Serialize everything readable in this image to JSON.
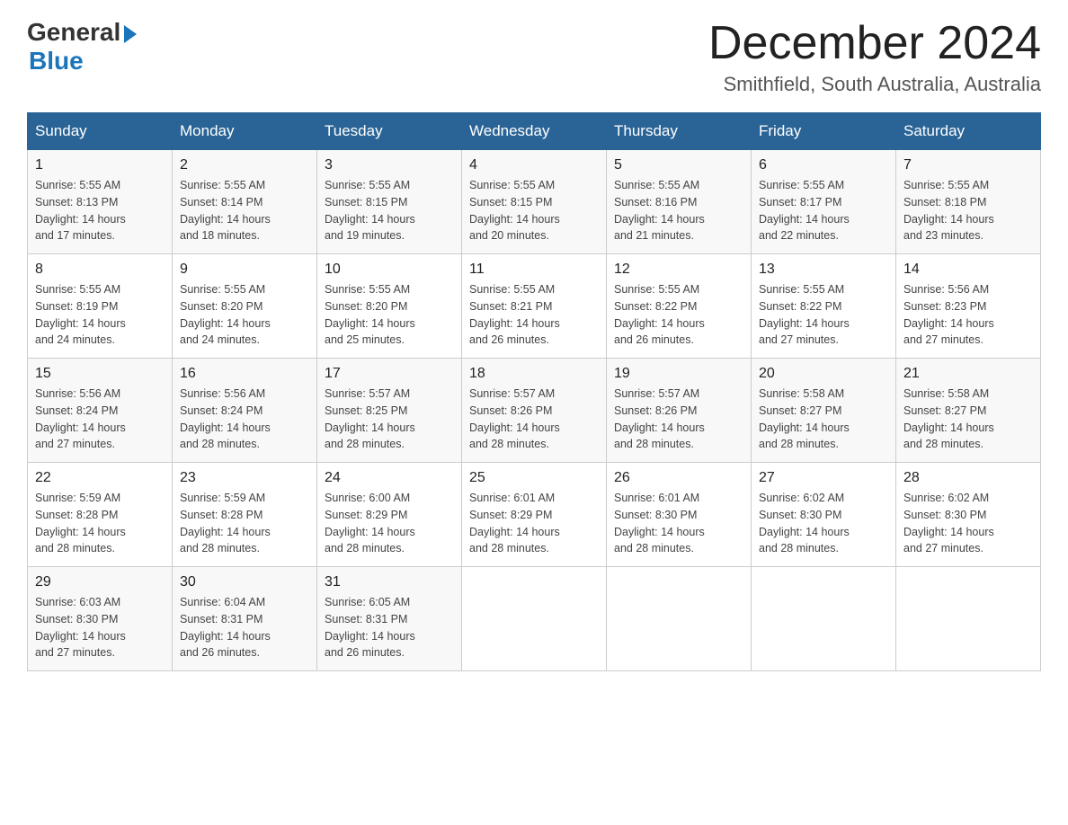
{
  "header": {
    "logo_general": "General",
    "logo_blue": "Blue",
    "month_title": "December 2024",
    "subtitle": "Smithfield, South Australia, Australia"
  },
  "weekdays": [
    "Sunday",
    "Monday",
    "Tuesday",
    "Wednesday",
    "Thursday",
    "Friday",
    "Saturday"
  ],
  "weeks": [
    [
      {
        "day": "1",
        "sunrise": "5:55 AM",
        "sunset": "8:13 PM",
        "daylight": "14 hours and 17 minutes."
      },
      {
        "day": "2",
        "sunrise": "5:55 AM",
        "sunset": "8:14 PM",
        "daylight": "14 hours and 18 minutes."
      },
      {
        "day": "3",
        "sunrise": "5:55 AM",
        "sunset": "8:15 PM",
        "daylight": "14 hours and 19 minutes."
      },
      {
        "day": "4",
        "sunrise": "5:55 AM",
        "sunset": "8:15 PM",
        "daylight": "14 hours and 20 minutes."
      },
      {
        "day": "5",
        "sunrise": "5:55 AM",
        "sunset": "8:16 PM",
        "daylight": "14 hours and 21 minutes."
      },
      {
        "day": "6",
        "sunrise": "5:55 AM",
        "sunset": "8:17 PM",
        "daylight": "14 hours and 22 minutes."
      },
      {
        "day": "7",
        "sunrise": "5:55 AM",
        "sunset": "8:18 PM",
        "daylight": "14 hours and 23 minutes."
      }
    ],
    [
      {
        "day": "8",
        "sunrise": "5:55 AM",
        "sunset": "8:19 PM",
        "daylight": "14 hours and 24 minutes."
      },
      {
        "day": "9",
        "sunrise": "5:55 AM",
        "sunset": "8:20 PM",
        "daylight": "14 hours and 24 minutes."
      },
      {
        "day": "10",
        "sunrise": "5:55 AM",
        "sunset": "8:20 PM",
        "daylight": "14 hours and 25 minutes."
      },
      {
        "day": "11",
        "sunrise": "5:55 AM",
        "sunset": "8:21 PM",
        "daylight": "14 hours and 26 minutes."
      },
      {
        "day": "12",
        "sunrise": "5:55 AM",
        "sunset": "8:22 PM",
        "daylight": "14 hours and 26 minutes."
      },
      {
        "day": "13",
        "sunrise": "5:55 AM",
        "sunset": "8:22 PM",
        "daylight": "14 hours and 27 minutes."
      },
      {
        "day": "14",
        "sunrise": "5:56 AM",
        "sunset": "8:23 PM",
        "daylight": "14 hours and 27 minutes."
      }
    ],
    [
      {
        "day": "15",
        "sunrise": "5:56 AM",
        "sunset": "8:24 PM",
        "daylight": "14 hours and 27 minutes."
      },
      {
        "day": "16",
        "sunrise": "5:56 AM",
        "sunset": "8:24 PM",
        "daylight": "14 hours and 28 minutes."
      },
      {
        "day": "17",
        "sunrise": "5:57 AM",
        "sunset": "8:25 PM",
        "daylight": "14 hours and 28 minutes."
      },
      {
        "day": "18",
        "sunrise": "5:57 AM",
        "sunset": "8:26 PM",
        "daylight": "14 hours and 28 minutes."
      },
      {
        "day": "19",
        "sunrise": "5:57 AM",
        "sunset": "8:26 PM",
        "daylight": "14 hours and 28 minutes."
      },
      {
        "day": "20",
        "sunrise": "5:58 AM",
        "sunset": "8:27 PM",
        "daylight": "14 hours and 28 minutes."
      },
      {
        "day": "21",
        "sunrise": "5:58 AM",
        "sunset": "8:27 PM",
        "daylight": "14 hours and 28 minutes."
      }
    ],
    [
      {
        "day": "22",
        "sunrise": "5:59 AM",
        "sunset": "8:28 PM",
        "daylight": "14 hours and 28 minutes."
      },
      {
        "day": "23",
        "sunrise": "5:59 AM",
        "sunset": "8:28 PM",
        "daylight": "14 hours and 28 minutes."
      },
      {
        "day": "24",
        "sunrise": "6:00 AM",
        "sunset": "8:29 PM",
        "daylight": "14 hours and 28 minutes."
      },
      {
        "day": "25",
        "sunrise": "6:01 AM",
        "sunset": "8:29 PM",
        "daylight": "14 hours and 28 minutes."
      },
      {
        "day": "26",
        "sunrise": "6:01 AM",
        "sunset": "8:30 PM",
        "daylight": "14 hours and 28 minutes."
      },
      {
        "day": "27",
        "sunrise": "6:02 AM",
        "sunset": "8:30 PM",
        "daylight": "14 hours and 28 minutes."
      },
      {
        "day": "28",
        "sunrise": "6:02 AM",
        "sunset": "8:30 PM",
        "daylight": "14 hours and 27 minutes."
      }
    ],
    [
      {
        "day": "29",
        "sunrise": "6:03 AM",
        "sunset": "8:30 PM",
        "daylight": "14 hours and 27 minutes."
      },
      {
        "day": "30",
        "sunrise": "6:04 AM",
        "sunset": "8:31 PM",
        "daylight": "14 hours and 26 minutes."
      },
      {
        "day": "31",
        "sunrise": "6:05 AM",
        "sunset": "8:31 PM",
        "daylight": "14 hours and 26 minutes."
      },
      null,
      null,
      null,
      null
    ]
  ],
  "labels": {
    "sunrise": "Sunrise:",
    "sunset": "Sunset:",
    "daylight": "Daylight:"
  }
}
